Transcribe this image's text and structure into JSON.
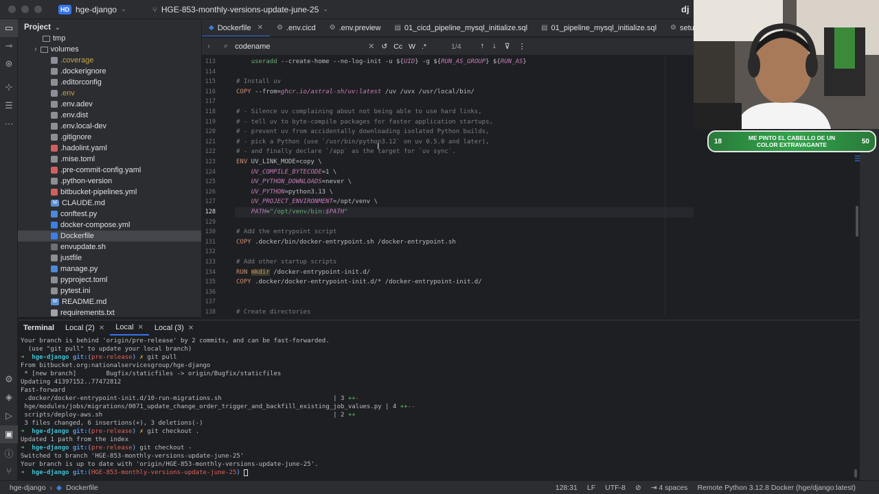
{
  "window": {
    "project_badge": "HD",
    "project_name": "hge-django",
    "branch": "HGE-853-monthly-versions-update-june-25",
    "user_initial": "dj"
  },
  "project_panel": {
    "title": "Project",
    "items": [
      {
        "label": "tmp",
        "icon": "folder-icon"
      },
      {
        "label": "volumes",
        "icon": "folder-icon"
      },
      {
        "label": ".coverage",
        "icon": "file-icon"
      },
      {
        "label": ".dockerignore",
        "icon": "file-icon"
      },
      {
        "label": ".editorconfig",
        "icon": "file-icon"
      },
      {
        "label": ".env",
        "icon": "file-icon"
      },
      {
        "label": ".env.adev",
        "icon": "file-icon"
      },
      {
        "label": ".env.dist",
        "icon": "file-icon"
      },
      {
        "label": ".env.local-dev",
        "icon": "file-icon"
      },
      {
        "label": ".gitignore",
        "icon": "file-icon"
      },
      {
        "label": ".hadolint.yaml",
        "icon": "yaml-icon"
      },
      {
        "label": ".mise.toml",
        "icon": "file-icon"
      },
      {
        "label": ".pre-commit-config.yaml",
        "icon": "yaml-icon"
      },
      {
        "label": ".python-version",
        "icon": "file-icon"
      },
      {
        "label": "bitbucket-pipelines.yml",
        "icon": "yaml-icon"
      },
      {
        "label": "CLAUDE.md",
        "icon": "markdown-icon"
      },
      {
        "label": "conftest.py",
        "icon": "python-icon"
      },
      {
        "label": "docker-compose.yml",
        "icon": "docker-icon"
      },
      {
        "label": "Dockerfile",
        "icon": "docker-icon"
      },
      {
        "label": "envupdate.sh",
        "icon": "shell-icon"
      },
      {
        "label": "justfile",
        "icon": "file-icon"
      },
      {
        "label": "manage.py",
        "icon": "python-icon"
      },
      {
        "label": "pyproject.toml",
        "icon": "file-icon"
      },
      {
        "label": "pytest.ini",
        "icon": "file-icon"
      },
      {
        "label": "README.md",
        "icon": "markdown-icon"
      },
      {
        "label": "requirements.txt",
        "icon": "text-icon"
      }
    ]
  },
  "editor_tabs": [
    {
      "label": "Dockerfile",
      "active": true
    },
    {
      "label": ".env.cicd"
    },
    {
      "label": ".env.preview"
    },
    {
      "label": "01_cicd_pipeline_mysql_initialize.sql"
    },
    {
      "label": "01_pipeline_mysql_initialize.sql"
    },
    {
      "label": "setup-test-environ"
    }
  ],
  "find_bar": {
    "query": "codename",
    "opt_case": "Cc",
    "opt_word": "W",
    "opt_regex": ".*",
    "count": "1/4"
  },
  "code_lines": [
    {
      "n": "113",
      "t": "    useradd --create-home --no-log-init -u ${UID} -g ${RUN_AS_GROUP} ${RUN_AS}"
    },
    {
      "n": "114",
      "t": ""
    },
    {
      "n": "115",
      "t": "# Install uv"
    },
    {
      "n": "116",
      "t": "COPY --from=ghcr.io/astral-sh/uv:latest /uv /uvx /usr/local/bin/"
    },
    {
      "n": "117",
      "t": ""
    },
    {
      "n": "118",
      "t": "# - Silence uv complaining about not being able to use hard links,"
    },
    {
      "n": "119",
      "t": "# - tell uv to byte-compile packages for faster application startups,"
    },
    {
      "n": "120",
      "t": "# - prevent uv from accidentally downloading isolated Python builds,"
    },
    {
      "n": "121",
      "t": "# - pick a Python (use `/usr/bin/python3.12` on uv 0.5.0 and later),"
    },
    {
      "n": "122",
      "t": "# - and finally declare `/app` as the target for `uv sync`."
    },
    {
      "n": "123",
      "t": "ENV UV_LINK_MODE=copy \\"
    },
    {
      "n": "124",
      "t": "    UV_COMPILE_BYTECODE=1 \\"
    },
    {
      "n": "125",
      "t": "    UV_PYTHON_DOWNLOADS=never \\"
    },
    {
      "n": "126",
      "t": "    UV_PYTHON=python3.13 \\"
    },
    {
      "n": "127",
      "t": "    UV_PROJECT_ENVIRONMENT=/opt/venv \\"
    },
    {
      "n": "128",
      "t": "    PATH=\"/opt/venv/bin:$PATH\""
    },
    {
      "n": "129",
      "t": ""
    },
    {
      "n": "130",
      "t": "# Add the entrypoint script"
    },
    {
      "n": "131",
      "t": "COPY .docker/bin/docker-entrypoint.sh /docker-entrypoint.sh"
    },
    {
      "n": "132",
      "t": ""
    },
    {
      "n": "133",
      "t": "# Add other startup scripts"
    },
    {
      "n": "134",
      "t": "RUN mkdir /docker-entrypoint-init.d/"
    },
    {
      "n": "135",
      "t": "COPY .docker/docker-entrypoint-init.d/* /docker-entrypoint-init.d/"
    },
    {
      "n": "136",
      "t": ""
    },
    {
      "n": "137",
      "t": ""
    },
    {
      "n": "138",
      "t": "# Create directories"
    }
  ],
  "terminal": {
    "tabs": [
      "Terminal",
      "Local (2)",
      "Local",
      "Local (3)"
    ],
    "lines": [
      "Your branch is behind 'origin/pre-release' by 2 commits, and can be fast-forwarded.",
      "  (use \"git pull\" to update your local branch)",
      "➜  hge-django git:(pre-release) ✗ git pull",
      "From bitbucket.org:nationalservicesgroup/hge-django",
      " * [new branch]        Bugfix/staticfiles -> origin/Bugfix/staticfiles",
      "Updating 41397152..77472812",
      "Fast-forward",
      " .docker/docker-entrypoint-init.d/10-run-migrations.sh                              | 3 ++-",
      " hge/modules/jobs/migrations/0071_update_change_order_trigger_and_backfill_existing_job_values.py | 4 ++--",
      " scripts/deploy-aws.sh                                                              | 2 ++",
      " 3 files changed, 6 insertions(+), 3 deletions(-)",
      "➜  hge-django git:(pre-release) ✗ git checkout .",
      "Updated 1 path from the index",
      "➜  hge-django git:(pre-release) git checkout -",
      "Switched to branch 'HGE-853-monthly-versions-update-june-25'",
      "Your branch is up to date with 'origin/HGE-853-monthly-versions-update-june-25'.",
      "➜  hge-django git:(HGE-853-monthly-versions-update-june-25) "
    ]
  },
  "status_bar": {
    "crumb_project": "hge-django",
    "crumb_file": "Dockerfile",
    "position": "128:31",
    "line_ending": "LF",
    "encoding": "UTF-8",
    "indent": "4 spaces",
    "interpreter": "Remote Python 3.12.8 Docker (hge/django:latest)"
  },
  "overlay": {
    "left_num": "18",
    "text": "ME PINTO EL CABELLO DE UN COLOR EXTRAVAGANTE",
    "right_num": "50"
  }
}
